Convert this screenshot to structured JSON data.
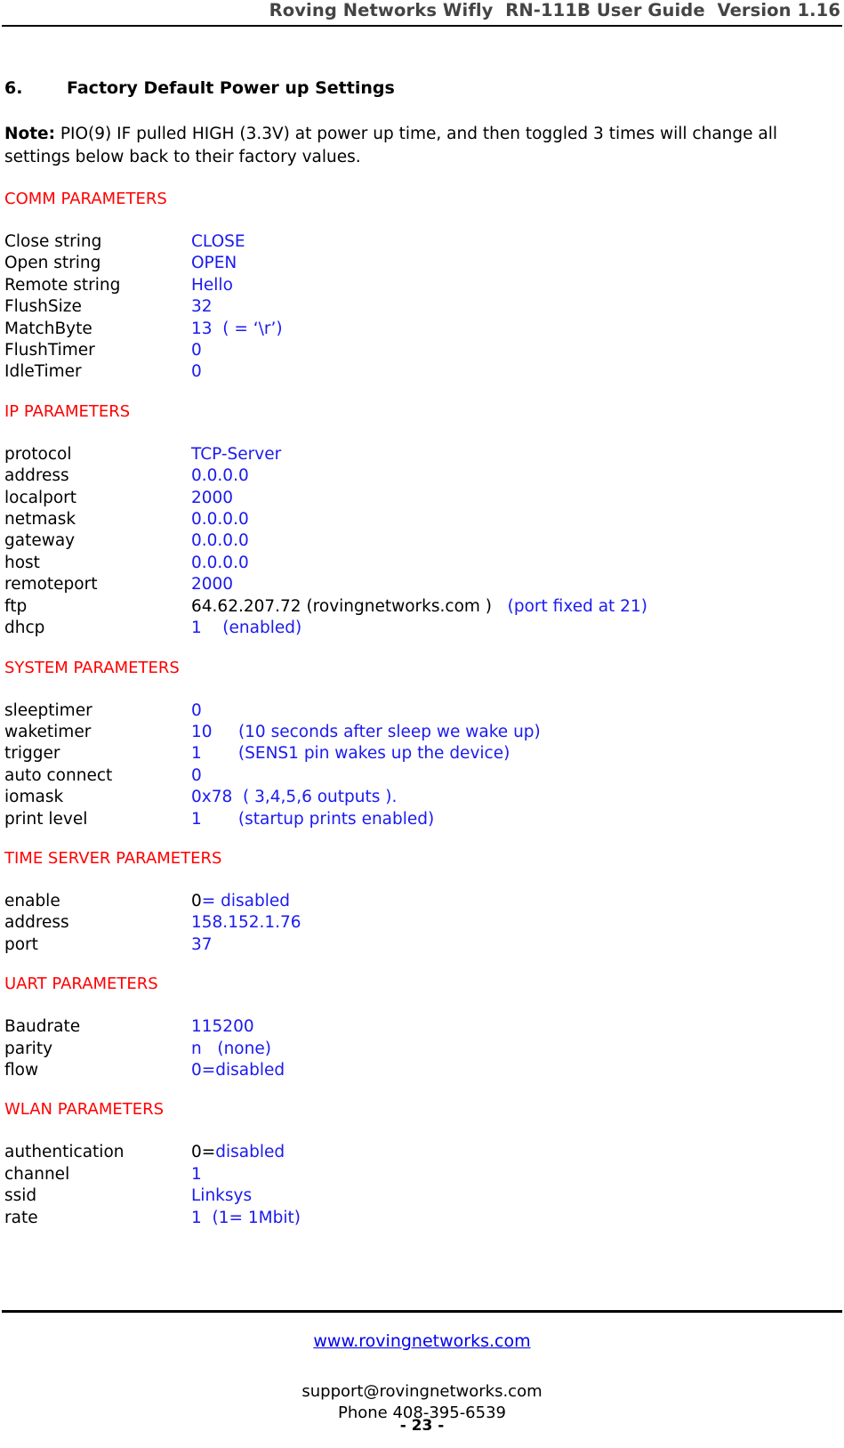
{
  "header": {
    "running_title": "Roving Networks Wifly  RN-111B User Guide  Version 1.16"
  },
  "section": {
    "number": "6.",
    "title": "Factory Default Power up Settings"
  },
  "note": {
    "lead": "Note:",
    "text": "  PIO(9) IF pulled HIGH (3.3V) at power up time,  and then toggled 3 times will change all settings below back to their factory values."
  },
  "groups": [
    {
      "title": "COMM PARAMETERS",
      "rows": [
        {
          "label": "Close string",
          "value": "CLOSE"
        },
        {
          "label": "Open string",
          "value": "OPEN"
        },
        {
          "label": "Remote string",
          "value": "Hello"
        },
        {
          "label": "FlushSize",
          "value": "32"
        },
        {
          "label": "MatchByte",
          "value": "13  ( = ‘\\r’)"
        },
        {
          "label": "FlushTimer",
          "value": "0"
        },
        {
          "label": "IdleTimer",
          "value": "0"
        }
      ]
    },
    {
      "title": "IP PARAMETERS",
      "rows": [
        {
          "label": "protocol",
          "value": "TCP-Server"
        },
        {
          "label": "address",
          "value": "0.0.0.0"
        },
        {
          "label": "localport",
          "value": "2000"
        },
        {
          "label": "netmask",
          "value": "0.0.0.0"
        },
        {
          "label": "gateway",
          "value": "0.0.0.0"
        },
        {
          "label": "host",
          "value": "0.0.0.0"
        },
        {
          "label": "remoteport",
          "value": "2000"
        },
        {
          "label": "ftp",
          "value_black": "64.62.207.72 (rovingnetworks.com )",
          "value_blue": "   (port fixed at 21)"
        },
        {
          "label": "dhcp",
          "value": "1    (enabled)"
        }
      ]
    },
    {
      "title": "SYSTEM PARAMETERS",
      "rows": [
        {
          "label": "sleeptimer",
          "value": "0"
        },
        {
          "label": "waketimer",
          "value": "10     (10 seconds after sleep we wake up)"
        },
        {
          "label": "trigger",
          "value": "1       (SENS1 pin wakes up the device)"
        },
        {
          "label": "auto connect",
          "value": "0"
        },
        {
          "label": "iomask",
          "value": "0x78  ( 3,4,5,6 outputs )."
        },
        {
          "label": "print level",
          "value": "1       (startup prints enabled)"
        }
      ]
    },
    {
      "title": "TIME SERVER PARAMETERS",
      "rows": [
        {
          "label": "enable",
          "value_black": "0",
          "value_blue": "= disabled"
        },
        {
          "label": "address",
          "value": "158.152.1.76"
        },
        {
          "label": "port",
          "value": "37"
        }
      ]
    },
    {
      "title": "UART PARAMETERS",
      "rows": [
        {
          "label": "Baudrate",
          "value": "115200"
        },
        {
          "label": "parity",
          "value": "n   (none)"
        },
        {
          "label": "flow",
          "value": "0=disabled"
        }
      ]
    },
    {
      "title": "WLAN PARAMETERS",
      "rows": [
        {
          "label": "authentication",
          "value_black": "0=",
          "value_blue": "disabled"
        },
        {
          "label": "channel",
          "value": "1"
        },
        {
          "label": "ssid",
          "value": "Linksys"
        },
        {
          "label": "rate",
          "value": "1  (1= 1Mbit)"
        }
      ]
    }
  ],
  "footer": {
    "website": "www.rovingnetworks.com",
    "email": "support@rovingnetworks.com",
    "phone": "Phone 408-395-6539",
    "page_number": "- 23 -"
  },
  "colors": {
    "heading_red": "#ff0000",
    "value_blue": "#1a1af0",
    "link_blue": "#0000ee",
    "header_gray": "#444444"
  }
}
